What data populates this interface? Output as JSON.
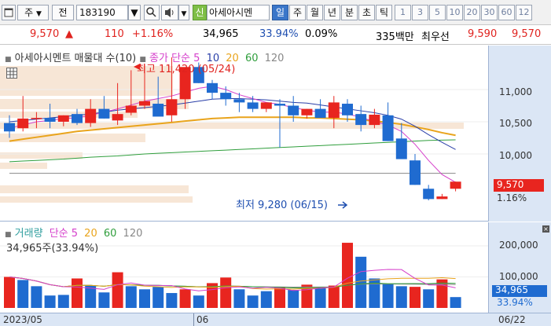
{
  "toolbar": {
    "market_label": "주",
    "prev_label": "전",
    "stock_code": "183190",
    "credit_badge": "신",
    "stock_name": "아세아시멘",
    "periods": [
      "일",
      "주",
      "월",
      "년",
      "분",
      "초",
      "틱"
    ],
    "selected_period": "일",
    "numbers": [
      "1",
      "3",
      "5",
      "10",
      "20",
      "30",
      "60",
      "12"
    ]
  },
  "quote": {
    "price": "9,570",
    "change": "110",
    "change_pct": "+1.16%",
    "volume": "34,965",
    "volume_ratio": "33.94%",
    "turnover": "0.09%",
    "amount": "335백만",
    "best_label": "최우선",
    "ask": "9,590",
    "bid": "9,570"
  },
  "price_chart": {
    "stock_label": "아세아시멘트 매물대 수(10)",
    "ma_title": "종가 단순",
    "ma_periods": [
      "5",
      "10",
      "20",
      "60",
      "120"
    ],
    "high_label": "최고 11,420 (05/24)",
    "low_label": "최저 9,280 (06/15)",
    "y_ticks": [
      "11,000",
      "10,500",
      "10,000"
    ],
    "last_price": "9,570",
    "last_pct": "1.16%"
  },
  "volume_chart": {
    "title": "거래량",
    "ma_title": "단순",
    "ma_periods": [
      "5",
      "20",
      "60",
      "120"
    ],
    "subtitle": "34,965주(33.94%)",
    "y_ticks": [
      "200,000",
      "100,000"
    ],
    "last_volume": "34,965",
    "last_ratio": "33.94%"
  },
  "dates": {
    "start": "2023/05",
    "mid": "06",
    "end": "06/22"
  },
  "colors": {
    "up": "#e8251f",
    "down": "#1f6bd0",
    "ma5": "#d53fcb",
    "ma10": "#2a3fa8",
    "ma20": "#e9a41c",
    "ma60": "#2f9e3c",
    "ma120": "#888888"
  },
  "chart_data": [
    {
      "type": "candlestick",
      "categories": [
        "05/03",
        "05/04",
        "05/08",
        "05/09",
        "05/10",
        "05/11",
        "05/12",
        "05/15",
        "05/16",
        "05/17",
        "05/18",
        "05/19",
        "05/22",
        "05/23",
        "05/24",
        "05/25",
        "05/26",
        "05/30",
        "05/31",
        "06/01",
        "06/02",
        "06/05",
        "06/07",
        "06/08",
        "06/09",
        "06/12",
        "06/13",
        "06/14",
        "06/15",
        "06/16",
        "06/19",
        "06/20",
        "06/21",
        "06/22"
      ],
      "ohlc": [
        [
          10480,
          10600,
          10250,
          10350
        ],
        [
          10400,
          10900,
          10350,
          10550
        ],
        [
          10550,
          10650,
          10400,
          10560
        ],
        [
          10560,
          10780,
          10400,
          10500
        ],
        [
          10500,
          10600,
          10430,
          10600
        ],
        [
          10620,
          10700,
          10450,
          10480
        ],
        [
          10480,
          10850,
          10420,
          10700
        ],
        [
          10700,
          10900,
          10550,
          10550
        ],
        [
          10520,
          11100,
          10450,
          10620
        ],
        [
          10640,
          11300,
          10600,
          10750
        ],
        [
          10750,
          11400,
          10700,
          10820
        ],
        [
          10780,
          11200,
          10600,
          10580
        ],
        [
          10600,
          11500,
          10500,
          10850
        ],
        [
          10850,
          11300,
          10700,
          11350
        ],
        [
          11350,
          11420,
          11100,
          11100
        ],
        [
          11100,
          11150,
          10850,
          10950
        ],
        [
          10950,
          11050,
          10750,
          10850
        ],
        [
          10850,
          10950,
          10650,
          10800
        ],
        [
          10800,
          10900,
          10650,
          10700
        ],
        [
          10700,
          10800,
          10650,
          10800
        ],
        [
          10780,
          10850,
          10100,
          10750
        ],
        [
          10750,
          10900,
          10500,
          10600
        ],
        [
          10600,
          10700,
          10550,
          10700
        ],
        [
          10700,
          10850,
          10600,
          10560
        ],
        [
          10560,
          10900,
          10400,
          10800
        ],
        [
          10780,
          10850,
          10500,
          10600
        ],
        [
          10620,
          10750,
          10350,
          10450
        ],
        [
          10450,
          10700,
          10400,
          10610
        ],
        [
          10600,
          10800,
          10200,
          10200
        ],
        [
          10240,
          10480,
          10050,
          9920
        ],
        [
          9900,
          10000,
          9520,
          9520
        ],
        [
          9460,
          9520,
          9280,
          9300
        ],
        [
          9300,
          9380,
          9300,
          9340
        ],
        [
          9460,
          9570,
          9420,
          9570
        ]
      ],
      "ma5": [
        10400,
        10450,
        10500,
        10520,
        10550,
        10560,
        10600,
        10650,
        10700,
        10760,
        10820,
        10860,
        10900,
        10960,
        11020,
        11050,
        11000,
        10920,
        10860,
        10800,
        10770,
        10720,
        10680,
        10650,
        10650,
        10620,
        10570,
        10500,
        10450,
        10350,
        10150,
        9900,
        9680,
        9560
      ],
      "ma10": [
        10500,
        10520,
        10540,
        10560,
        10580,
        10600,
        10620,
        10650,
        10680,
        10700,
        10720,
        10740,
        10760,
        10790,
        10820,
        10850,
        10860,
        10860,
        10850,
        10840,
        10820,
        10800,
        10790,
        10760,
        10730,
        10700,
        10670,
        10640,
        10600,
        10540,
        10430,
        10300,
        10180,
        10070
      ],
      "ma20": [
        10200,
        10230,
        10260,
        10290,
        10320,
        10350,
        10370,
        10390,
        10410,
        10430,
        10450,
        10470,
        10490,
        10510,
        10530,
        10550,
        10560,
        10570,
        10570,
        10570,
        10570,
        10570,
        10560,
        10560,
        10550,
        10540,
        10530,
        10510,
        10490,
        10460,
        10420,
        10380,
        10330,
        10290
      ],
      "ma60": [
        9880,
        9890,
        9900,
        9910,
        9920,
        9935,
        9950,
        9960,
        9970,
        9985,
        10000,
        10010,
        10020,
        10030,
        10040,
        10050,
        10060,
        10070,
        10080,
        10090,
        10100,
        10110,
        10120,
        10130,
        10140,
        10150,
        10160,
        10170,
        10180,
        10190,
        10200,
        10210,
        10215,
        10220
      ],
      "ma120": [
        9700,
        9700,
        9700,
        9700,
        9700,
        9700,
        9700,
        9700,
        9700,
        9700,
        9700,
        9700,
        9700,
        9700,
        9700,
        9700,
        9700,
        9700,
        9700,
        9700,
        9700,
        9700,
        9700,
        9700,
        9700,
        9700,
        9700,
        9700,
        9700,
        9700,
        9700,
        9700,
        9700,
        9700
      ]
    },
    {
      "type": "bar",
      "name": "거래량",
      "volumes": [
        100000,
        90000,
        70000,
        40000,
        42000,
        95000,
        72000,
        50000,
        115000,
        70000,
        60000,
        68000,
        48000,
        60000,
        40000,
        80000,
        98000,
        60000,
        40000,
        54000,
        68000,
        58000,
        75000,
        64000,
        72000,
        210000,
        165000,
        95000,
        78000,
        70000,
        68000,
        60000,
        92000,
        34965
      ],
      "up_flags": [
        1,
        0,
        0,
        0,
        0,
        1,
        0,
        0,
        1,
        0,
        0,
        0,
        0,
        1,
        0,
        1,
        1,
        0,
        0,
        0,
        1,
        0,
        1,
        0,
        1,
        1,
        0,
        0,
        0,
        0,
        1,
        0,
        1,
        0
      ],
      "y_ticks": [
        200000,
        100000
      ]
    }
  ]
}
